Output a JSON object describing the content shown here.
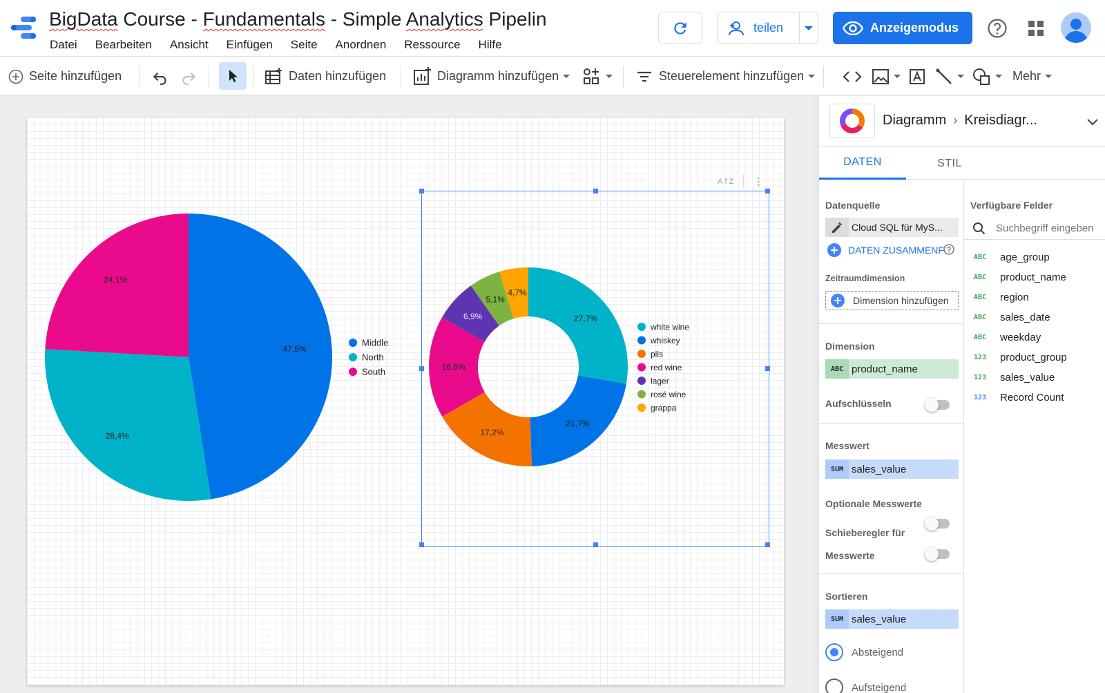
{
  "header": {
    "title_parts": [
      "BigData",
      " Course - ",
      "Fundamentals",
      " - Simple ",
      "Analytics",
      " Pipelin"
    ],
    "menu": [
      "Datei",
      "Bearbeiten",
      "Ansicht",
      "Einfügen",
      "Seite",
      "Anordnen",
      "Ressource",
      "Hilfe"
    ],
    "share_label": "teilen",
    "view_mode_label": "Anzeigemodus"
  },
  "toolbar": {
    "add_page": "Seite hinzufügen",
    "add_data": "Daten hinzufügen",
    "add_chart": "Diagramm hinzufügen",
    "add_control": "Steuerelement hinzufügen",
    "more": "Mehr"
  },
  "chart_data": [
    {
      "type": "pie",
      "categories": [
        "Middle",
        "North",
        "South"
      ],
      "values": [
        47.5,
        28.4,
        24.1
      ],
      "labels": [
        "47,5%",
        "28,4%",
        "24,1%"
      ],
      "colors": [
        "#0073e6",
        "#00b3c8",
        "#ea0b8c"
      ],
      "legend": "right"
    },
    {
      "type": "pie",
      "donut": true,
      "categories": [
        "white wine",
        "whiskey",
        "pils",
        "red wine",
        "lager",
        "rosé wine",
        "grappa"
      ],
      "values": [
        27.7,
        21.7,
        17.2,
        16.6,
        6.9,
        5.1,
        4.7
      ],
      "labels": [
        "27,7%",
        "21,7%",
        "17,2%",
        "16,6%",
        "6,9%",
        "5,1%",
        "4,7%"
      ],
      "colors": [
        "#00b3c8",
        "#0073e6",
        "#f47200",
        "#ea0b8c",
        "#5e35b1",
        "#7cb342",
        "#ffa400"
      ],
      "legend": "right"
    }
  ],
  "panel": {
    "crumb_root": "Diagramm",
    "crumb_leaf": "Kreisdiagr...",
    "tabs": [
      "DATEN",
      "STIL"
    ],
    "datasource_label": "Datenquelle",
    "datasource_value": "Cloud SQL für MyS...",
    "blend_label": "DATEN ZUSAMMENFÜ",
    "daterange_label": "Zeitraumdimension",
    "add_dimension": "Dimension hinzufügen",
    "dimension_label": "Dimension",
    "dimension_tag": "ABC",
    "dimension_value": "product_name",
    "drilldown_label": "Aufschlüsseln",
    "metric_label": "Messwert",
    "metric_tag": "SUM",
    "metric_value": "sales_value",
    "optional_metrics_label": "Optionale Messwerte",
    "metric_slider_label_1": "Schieberegler für",
    "metric_slider_label_2": "Messwerte",
    "sort_label": "Sortieren",
    "sort_tag": "SUM",
    "sort_value": "sales_value",
    "sort_desc": "Absteigend",
    "sort_asc": "Aufsteigend",
    "available_fields_label": "Verfügbare Felder",
    "search_placeholder": "Suchbegriff eingeben",
    "fields": [
      {
        "type": "ABC",
        "name": "age_group"
      },
      {
        "type": "ABC",
        "name": "product_name"
      },
      {
        "type": "ABC",
        "name": "region"
      },
      {
        "type": "ABC",
        "name": "sales_date"
      },
      {
        "type": "ABC",
        "name": "weekday"
      },
      {
        "type": "123",
        "name": "product_group"
      },
      {
        "type": "123",
        "name": "sales_value"
      },
      {
        "type": "123",
        "name": "Record Count"
      }
    ]
  }
}
